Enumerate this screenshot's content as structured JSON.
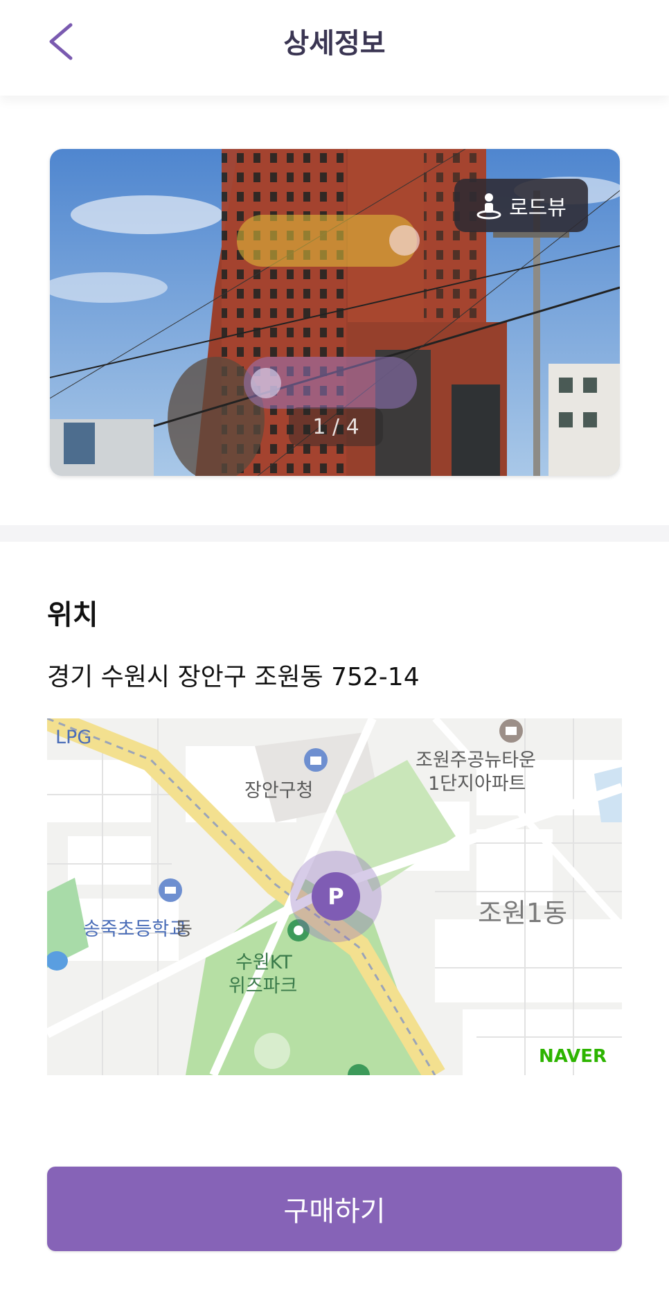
{
  "header": {
    "title": "상세정보",
    "back_icon": "chevron-left-icon"
  },
  "photo": {
    "roadview_label": "로드뷰",
    "counter": "1 / 4",
    "roadview_icon": "person-pin-icon"
  },
  "location": {
    "title": "위치",
    "address": "경기 수원시 장안구 조원동 752-14"
  },
  "map": {
    "labels": {
      "lpg": "LPG",
      "city_hall": "장안구청",
      "apartment_line1": "조원주공뉴타운",
      "apartment_line2": "1단지아파트",
      "school": "송죽초등학교",
      "dong_suffix": "동",
      "park_line1": "수원KT",
      "park_line2": "위즈파크",
      "dong": "조원1동",
      "naver": "NAVER"
    },
    "marker_label": "P"
  },
  "actions": {
    "buy_label": "구매하기"
  },
  "colors": {
    "accent": "#8663b7",
    "marker": "#7f5cb4",
    "title": "#3a3552"
  }
}
